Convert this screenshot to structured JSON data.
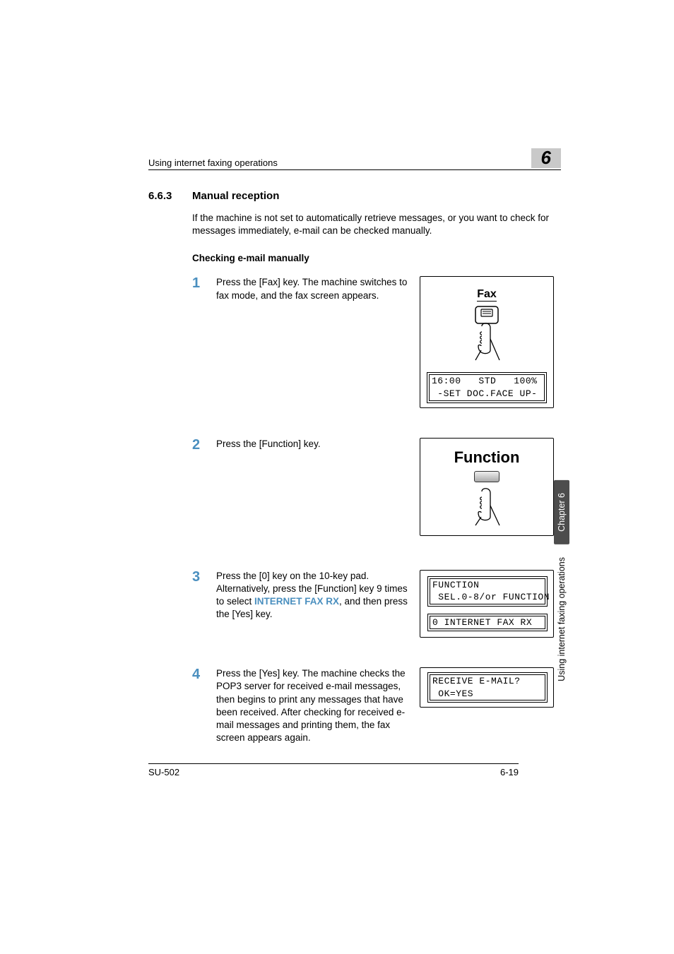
{
  "header": {
    "left": "Using internet faxing operations",
    "right": "6"
  },
  "section": {
    "number": "6.6.3",
    "title": "Manual reception",
    "intro": "If the machine is not set to automatically retrieve messages, or you want to check for messages immediately, e-mail can be checked manually.",
    "subTitle": "Checking e-mail manually"
  },
  "steps": {
    "s1": {
      "num": "1",
      "text": "Press the [Fax] key. The machine switches to fax mode, and the fax screen appears."
    },
    "s2": {
      "num": "2",
      "text": "Press the [Function] key."
    },
    "s3": {
      "num": "3",
      "textA": "Press the [0] key on the 10-key pad. Alternatively, press the [Function] key 9 times to select ",
      "hl": "INTERNET FAX RX",
      "textB": ", and then press the [Yes] key."
    },
    "s4": {
      "num": "4",
      "text": "Press the [Yes] key. The machine checks the POP3 server for received e-mail messages, then begins to print any messages that have been received. After checking for received e-mail messages and printing them, the fax screen appears again."
    }
  },
  "figures": {
    "fax": {
      "caption": "Fax",
      "lcd1": "16:00   STD   100%",
      "lcd2": " -SET DOC.FACE UP-"
    },
    "function": {
      "caption": "Function"
    },
    "step3": {
      "lcd1a": "FUNCTION",
      "lcd1b": " SEL.0-8/or FUNCTION",
      "lcd2": "0 INTERNET FAX RX"
    },
    "step4": {
      "lcd1a": "RECEIVE E-MAIL?",
      "lcd1b": " OK=YES"
    }
  },
  "sideTab": {
    "chapter": "Chapter 6",
    "caption": "Using internet faxing operations"
  },
  "footer": {
    "left": "SU-502",
    "right": "6-19"
  }
}
